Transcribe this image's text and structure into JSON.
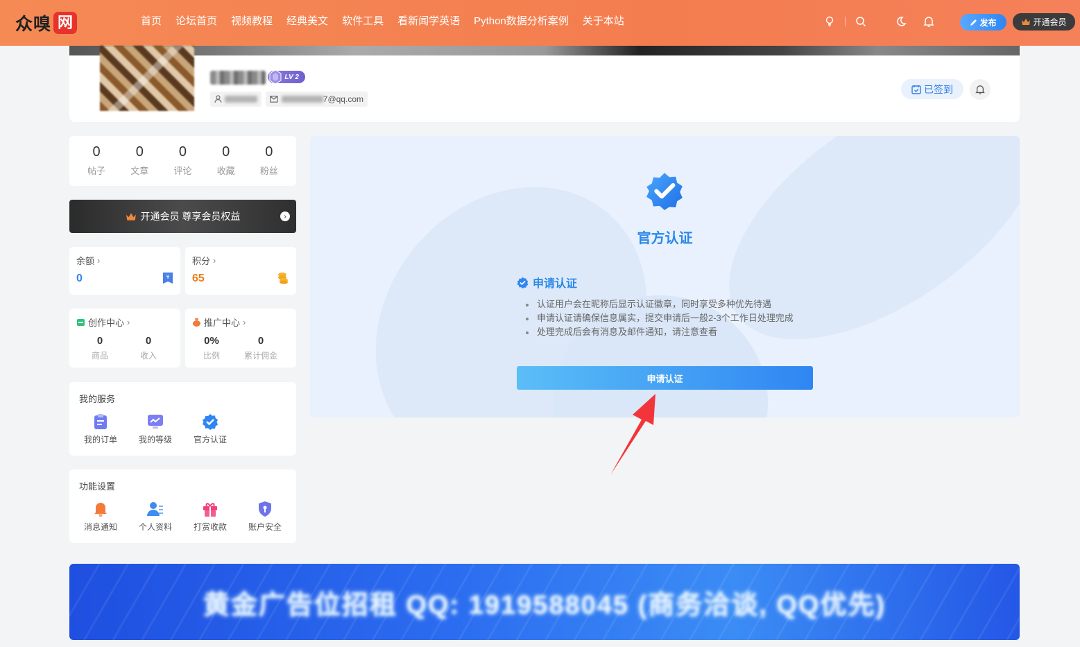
{
  "header": {
    "logo_text": "众嗅",
    "logo_badge": "网",
    "nav": [
      "首页",
      "论坛首页",
      "视频教程",
      "经典美文",
      "软件工具",
      "看新闻学英语",
      "Python数据分析案例",
      "关于本站"
    ],
    "publish_label": "发布",
    "vip_label": "开通会员"
  },
  "profile": {
    "level": "LV 2",
    "email_suffix": "7@qq.com",
    "signed_label": "已签到"
  },
  "stats": [
    {
      "value": "0",
      "label": "帖子"
    },
    {
      "value": "0",
      "label": "文章"
    },
    {
      "value": "0",
      "label": "评论"
    },
    {
      "value": "0",
      "label": "收藏"
    },
    {
      "value": "0",
      "label": "粉丝"
    }
  ],
  "vip_banner": "开通会员 尊享会员权益",
  "balance": {
    "label": "余额",
    "value": "0"
  },
  "points": {
    "label": "积分",
    "value": "65"
  },
  "creation": {
    "label": "创作中心",
    "items": [
      {
        "value": "0",
        "label": "商品"
      },
      {
        "value": "0",
        "label": "收入"
      }
    ]
  },
  "promotion": {
    "label": "推广中心",
    "items": [
      {
        "value": "0%",
        "label": "比例"
      },
      {
        "value": "0",
        "label": "累计佣金"
      }
    ]
  },
  "services": {
    "title": "我的服务",
    "items": [
      "我的订单",
      "我的等级",
      "官方认证"
    ]
  },
  "settings": {
    "title": "功能设置",
    "items": [
      "消息通知",
      "个人资料",
      "打赏收款",
      "账户安全"
    ]
  },
  "main": {
    "title": "官方认证",
    "apply_heading": "申请认证",
    "bullets": [
      "认证用户会在昵称后显示认证徽章，同时享受多种优先待遇",
      "申请认证请确保信息属实，提交申请后一般2-3个工作日处理完成",
      "处理完成后会有消息及邮件通知，请注意查看"
    ],
    "apply_button": "申请认证"
  },
  "ad": {
    "text": "黄金广告位招租 QQ: 1919588045 (商务洽谈, QQ优先)"
  },
  "colors": {
    "header": "#f47d4f",
    "accent": "#2a87e8",
    "points": "#f07c1a",
    "balance": "#2f86f2"
  }
}
